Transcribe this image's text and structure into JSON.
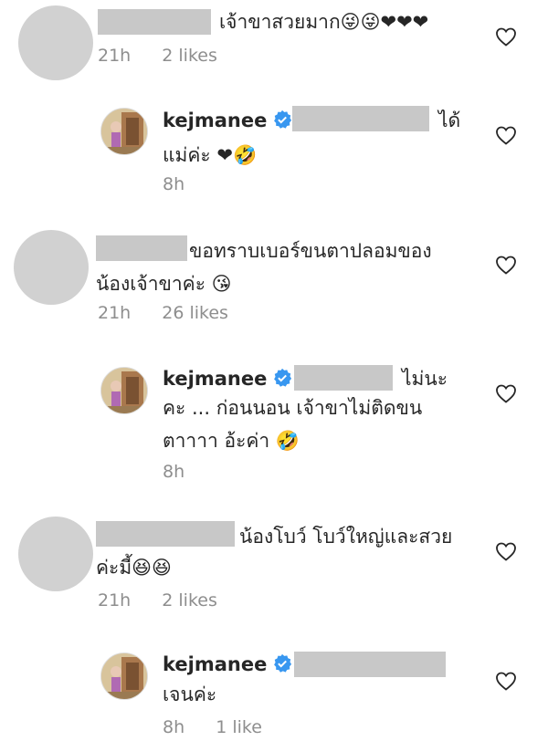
{
  "comments": [
    {
      "text1": "เจ้าขาสวยมาก😜😜❤❤❤",
      "time": "21h",
      "likes": "2 likes"
    },
    {
      "username": "kejmanee",
      "text1": "ได้",
      "text2": "แม่ค่ะ ❤🤣",
      "time": "8h"
    },
    {
      "text1": "ขอทราบเบอร์ขนตาปลอมของ",
      "text2": "น้องเจ้าขาค่ะ 😘",
      "time": "21h",
      "likes": "26 likes"
    },
    {
      "username": "kejmanee",
      "text1": "ไม่นะ",
      "text2": "คะ ... ก่อนนอน เจ้าขาไม่ติดขน",
      "text3": "ตาาาา อ้ะค่า 🤣",
      "time": "8h"
    },
    {
      "text1": "น้องโบว์ โบว์ใหญ่และสวย",
      "text2": "ค่ะมี้😆😆",
      "time": "21h",
      "likes": "2 likes"
    },
    {
      "username": "kejmanee",
      "text2": "เจนค่ะ",
      "time": "8h",
      "likes": "1 like"
    }
  ],
  "icons": {
    "heart": "heart-outline-icon",
    "verified": "verified-badge-icon"
  },
  "colors": {
    "text": "#262626",
    "meta": "#8e8e8e",
    "verified": "#3897f0",
    "redaction": "#c8c8c8",
    "avatar_placeholder": "#d1d1d1"
  }
}
